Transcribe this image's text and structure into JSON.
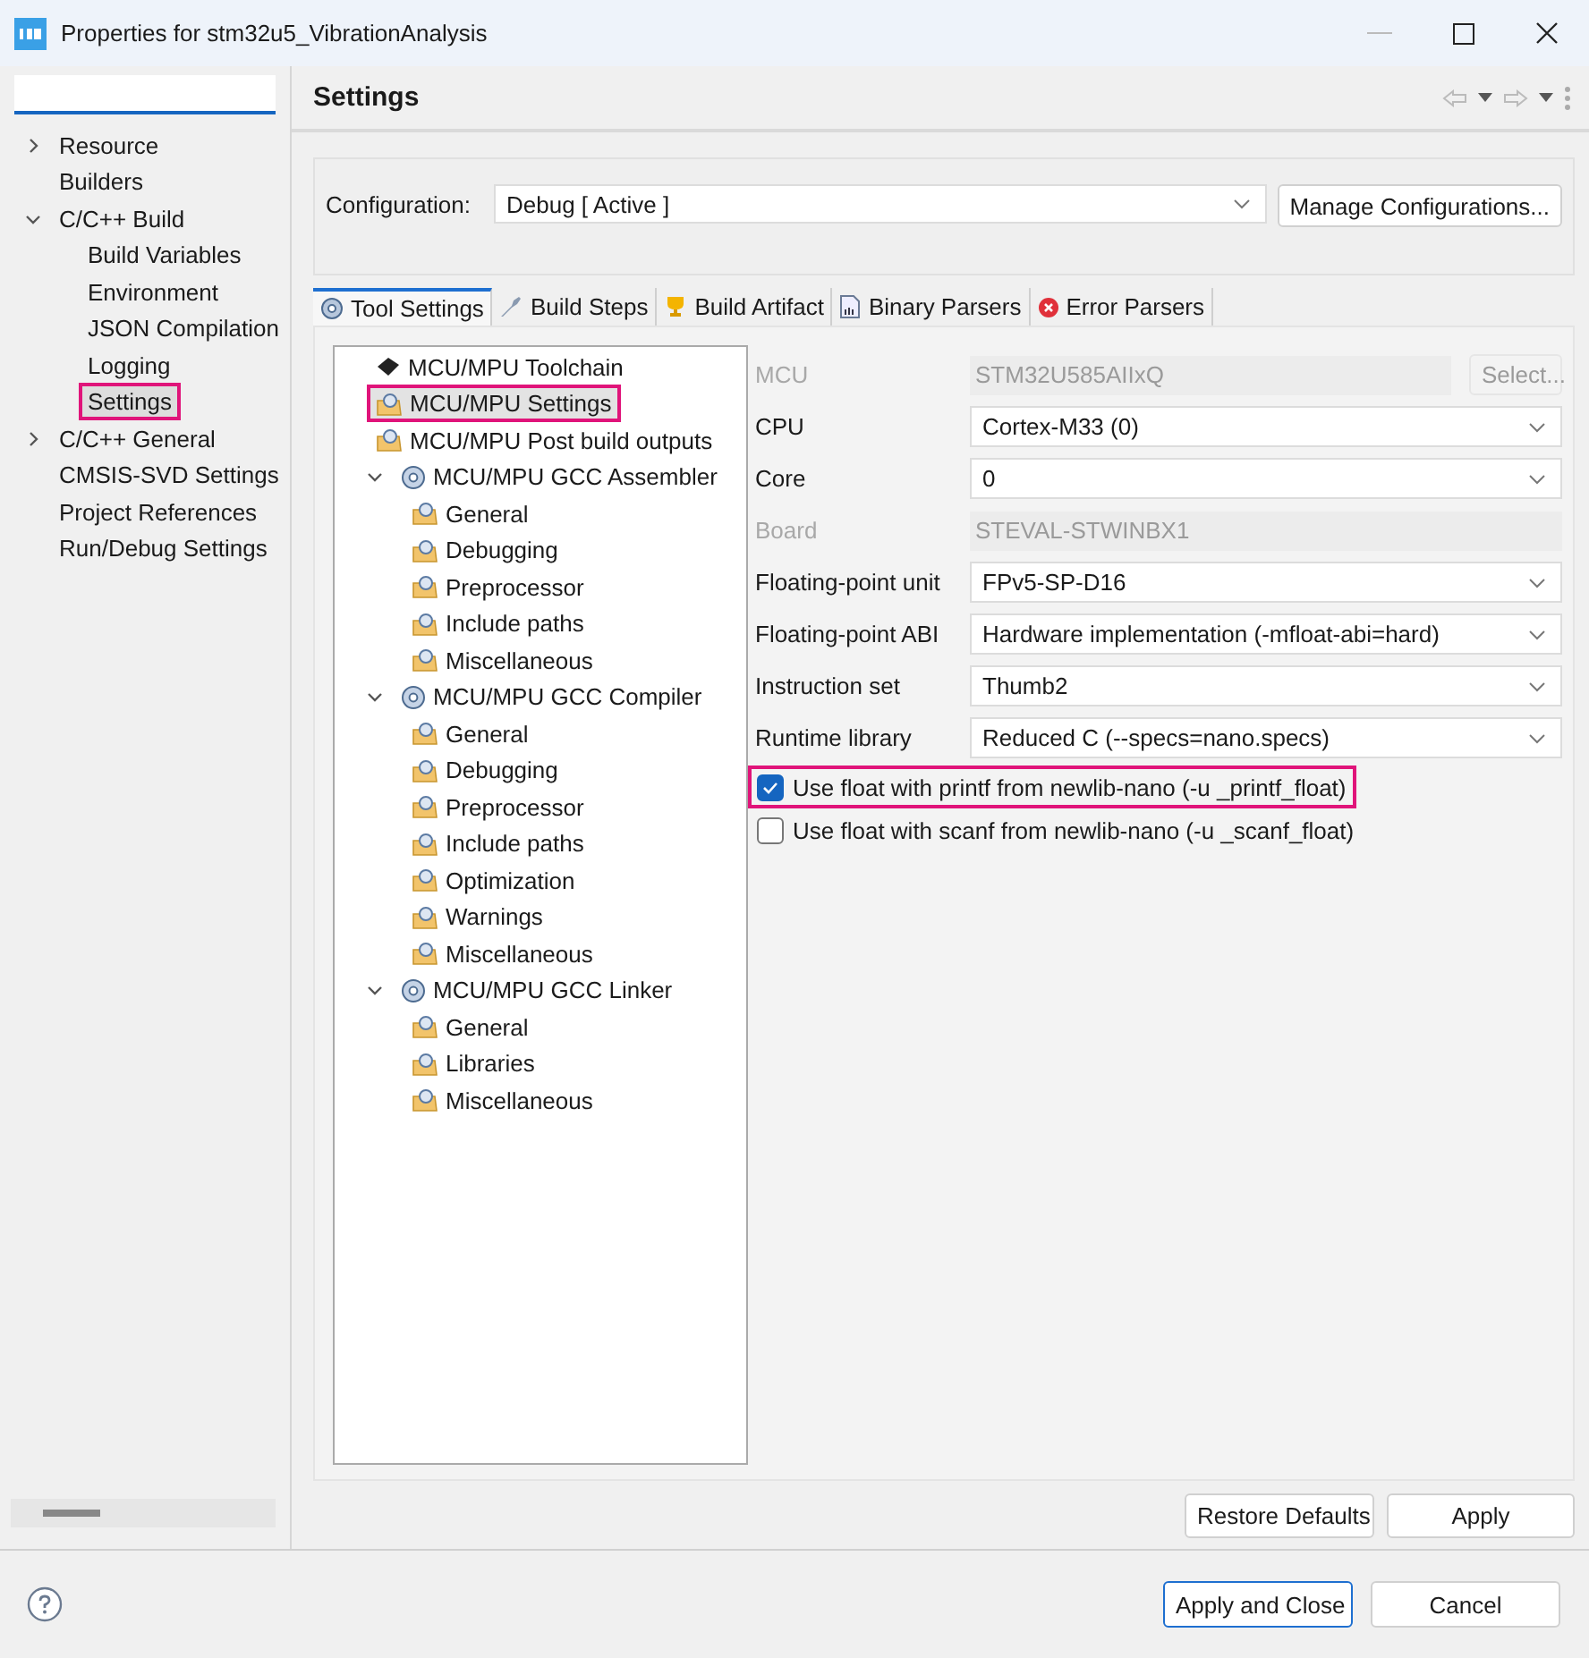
{
  "window": {
    "title": "Properties for stm32u5_VibrationAnalysis"
  },
  "sidebar": {
    "items": [
      {
        "label": "Resource",
        "kind": "folder",
        "expanded": false,
        "selected": false,
        "highlighted": false
      },
      {
        "label": "Builders",
        "kind": "leaf",
        "selected": false,
        "highlighted": false
      },
      {
        "label": "C/C++ Build",
        "kind": "folder",
        "expanded": true,
        "selected": false,
        "highlighted": false,
        "children": [
          {
            "label": "Build Variables",
            "selected": false,
            "highlighted": false
          },
          {
            "label": "Environment",
            "selected": false,
            "highlighted": false
          },
          {
            "label": "JSON Compilation",
            "selected": false,
            "highlighted": false
          },
          {
            "label": "Logging",
            "selected": false,
            "highlighted": false
          },
          {
            "label": "Settings",
            "selected": true,
            "highlighted": true
          }
        ]
      },
      {
        "label": "C/C++ General",
        "kind": "folder",
        "expanded": false,
        "selected": false,
        "highlighted": false
      },
      {
        "label": "CMSIS-SVD Settings",
        "kind": "leaf",
        "selected": false,
        "highlighted": false
      },
      {
        "label": "Project References",
        "kind": "leaf",
        "selected": false,
        "highlighted": false
      },
      {
        "label": "Run/Debug Settings",
        "kind": "leaf",
        "selected": false,
        "highlighted": false
      }
    ]
  },
  "page": {
    "title": "Settings",
    "configuration": {
      "label": "Configuration:",
      "value": "Debug  [ Active ]",
      "button": "Manage Configurations..."
    },
    "tabs": [
      {
        "label": "Tool Settings",
        "selected": true
      },
      {
        "label": "Build Steps",
        "selected": false
      },
      {
        "label": "Build Artifact",
        "selected": false
      },
      {
        "label": "Binary Parsers",
        "selected": false
      },
      {
        "label": "Error Parsers",
        "selected": false
      }
    ],
    "tool_tree": [
      {
        "label": "MCU/MPU Toolchain",
        "kind": "toolchain",
        "selected": false,
        "highlighted": false
      },
      {
        "label": "MCU/MPU Settings",
        "kind": "category",
        "selected": true,
        "highlighted": true
      },
      {
        "label": "MCU/MPU Post build outputs",
        "kind": "category",
        "selected": false,
        "highlighted": false
      },
      {
        "label": "MCU/MPU GCC Assembler",
        "kind": "tool",
        "selected": false,
        "highlighted": false,
        "expanded": true,
        "children": [
          {
            "label": "General",
            "selected": false,
            "highlighted": false
          },
          {
            "label": "Debugging",
            "selected": false,
            "highlighted": false
          },
          {
            "label": "Preprocessor",
            "selected": false,
            "highlighted": false
          },
          {
            "label": "Include paths",
            "selected": false,
            "highlighted": false
          },
          {
            "label": "Miscellaneous",
            "selected": false,
            "highlighted": false
          }
        ]
      },
      {
        "label": "MCU/MPU GCC Compiler",
        "kind": "tool",
        "selected": false,
        "highlighted": false,
        "expanded": true,
        "children": [
          {
            "label": "General",
            "selected": false,
            "highlighted": false
          },
          {
            "label": "Debugging",
            "selected": false,
            "highlighted": false
          },
          {
            "label": "Preprocessor",
            "selected": false,
            "highlighted": false
          },
          {
            "label": "Include paths",
            "selected": false,
            "highlighted": false
          },
          {
            "label": "Optimization",
            "selected": false,
            "highlighted": false
          },
          {
            "label": "Warnings",
            "selected": false,
            "highlighted": false
          },
          {
            "label": "Miscellaneous",
            "selected": false,
            "highlighted": false
          }
        ]
      },
      {
        "label": "MCU/MPU GCC Linker",
        "kind": "tool",
        "selected": false,
        "highlighted": false,
        "expanded": true,
        "children": [
          {
            "label": "General",
            "selected": false,
            "highlighted": false
          },
          {
            "label": "Libraries",
            "selected": false,
            "highlighted": false
          },
          {
            "label": "Miscellaneous",
            "selected": false,
            "highlighted": false
          }
        ]
      }
    ],
    "fields": [
      {
        "label": "MCU",
        "kind": "readonly",
        "value": "STM32U585AIIxQ",
        "disabled": true,
        "button": "Select..."
      },
      {
        "label": "CPU",
        "kind": "select",
        "value": "Cortex-M33 (0)",
        "disabled": false
      },
      {
        "label": "Core",
        "kind": "select",
        "value": "0",
        "disabled": false
      },
      {
        "label": "Board",
        "kind": "readonly",
        "value": "STEVAL-STWINBX1",
        "disabled": true
      },
      {
        "label": "Floating-point unit",
        "kind": "select",
        "value": "FPv5-SP-D16",
        "disabled": false
      },
      {
        "label": "Floating-point ABI",
        "kind": "select",
        "value": "Hardware implementation (-mfloat-abi=hard)",
        "disabled": false
      },
      {
        "label": "Instruction set",
        "kind": "select",
        "value": "Thumb2",
        "disabled": false
      },
      {
        "label": "Runtime library",
        "kind": "select",
        "value": "Reduced C (--specs=nano.specs)",
        "disabled": false
      }
    ],
    "options": [
      {
        "label": "Use float with printf from newlib-nano (-u _printf_float)",
        "checked": true,
        "highlighted": true
      },
      {
        "label": "Use float with scanf from newlib-nano (-u _scanf_float)",
        "checked": false,
        "highlighted": false
      }
    ],
    "buttons": [
      "Restore Defaults",
      "Apply"
    ]
  },
  "footer": {
    "buttons": [
      {
        "label": "Apply and Close",
        "default": true
      },
      {
        "label": "Cancel",
        "default": false
      }
    ]
  }
}
